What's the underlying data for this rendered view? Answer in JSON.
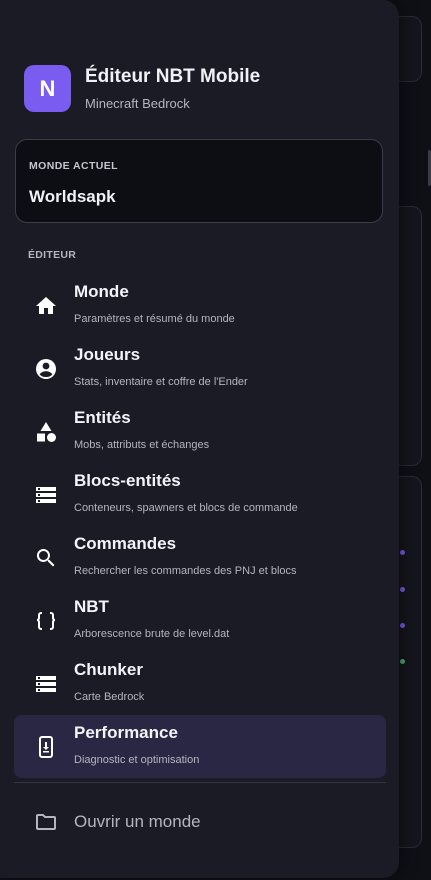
{
  "app": {
    "avatar_letter": "N",
    "title": "Éditeur NBT Mobile",
    "subtitle": "Minecraft Bedrock"
  },
  "world": {
    "label": "MONDE ACTUEL",
    "name": "Worldsapk"
  },
  "section_label": "ÉDITEUR",
  "nav": {
    "items": [
      {
        "icon": "home-icon",
        "title": "Monde",
        "desc": "Paramètres et résumé du monde",
        "active": false
      },
      {
        "icon": "account-circle-icon",
        "title": "Joueurs",
        "desc": "Stats, inventaire et coffre de l'Ender",
        "active": false
      },
      {
        "icon": "category-shapes-icon",
        "title": "Entités",
        "desc": "Mobs, attributs et échanges",
        "active": false
      },
      {
        "icon": "storage-icon",
        "title": "Blocs-entités",
        "desc": "Conteneurs, spawners et blocs de commande",
        "active": false
      },
      {
        "icon": "search-icon",
        "title": "Commandes",
        "desc": "Rechercher les commandes des PNJ et blocs",
        "active": false
      },
      {
        "icon": "data-object-icon",
        "title": "NBT",
        "desc": "Arborescence brute de level.dat",
        "active": false
      },
      {
        "icon": "storage-icon",
        "title": "Chunker",
        "desc": "Carte Bedrock",
        "active": false
      },
      {
        "icon": "phone-download-icon",
        "title": "Performance",
        "desc": "Diagnostic et optimisation",
        "active": true
      }
    ]
  },
  "footer": {
    "open_world_icon": "folder-icon",
    "open_world_label": "Ouvrir un monde"
  },
  "colors": {
    "accent": "#7b5cf0",
    "drawer_bg": "#1a1b24",
    "active_bg": "#2a2744",
    "page_bg": "#0f1016"
  }
}
